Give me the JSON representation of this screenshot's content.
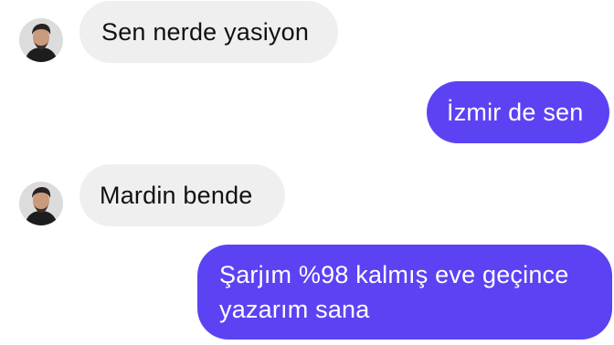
{
  "messages": [
    {
      "side": "incoming",
      "text": "Sen nerde yasiyon"
    },
    {
      "side": "outgoing",
      "text": "İzmir de sen"
    },
    {
      "side": "incoming",
      "text": "Mardin bende"
    },
    {
      "side": "outgoing",
      "line1": "Şarjım %98 kalmış eve geçince",
      "line2": "yazarım sana"
    }
  ],
  "colors": {
    "incoming_bubble": "#efefef",
    "outgoing_bubble": "#5b43f3",
    "incoming_text": "#111111",
    "outgoing_text": "#ffffff"
  },
  "icons": {
    "avatar": "contact-avatar-icon"
  }
}
